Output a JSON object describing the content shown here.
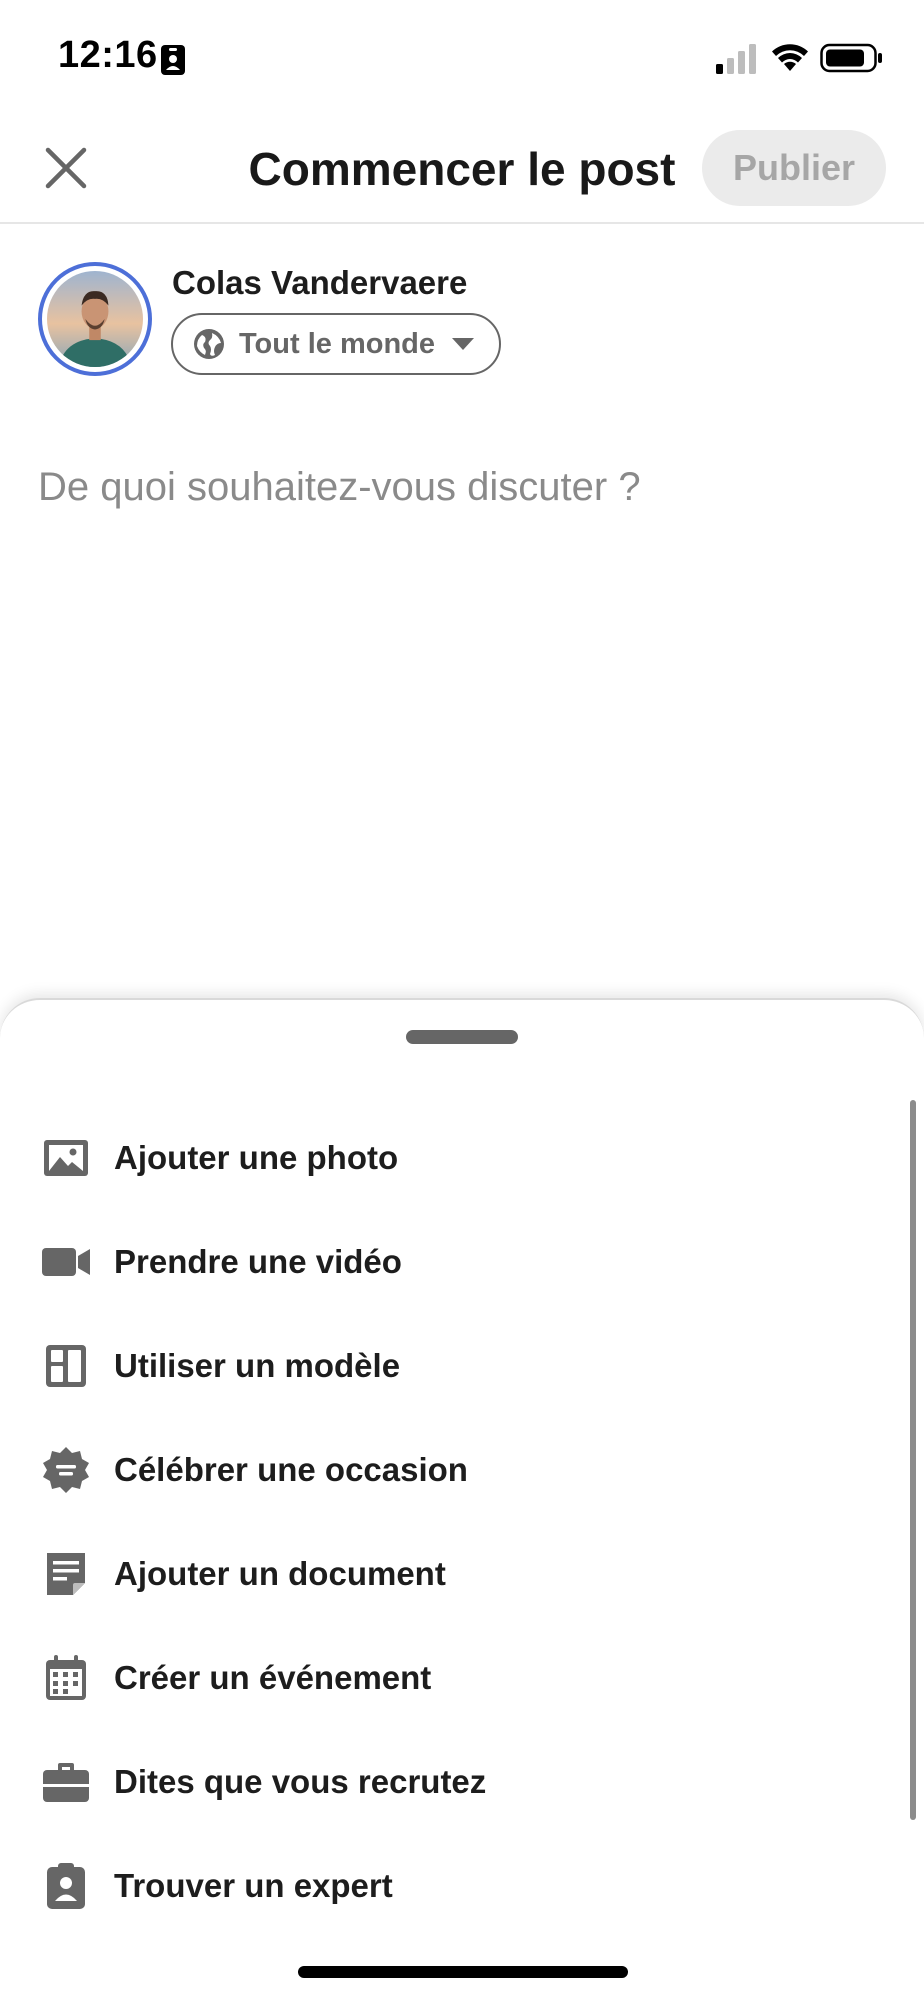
{
  "status_bar": {
    "time": "12:16",
    "badge_icon": "person-badge-icon",
    "signal_icon": "cellular-signal-icon",
    "wifi_icon": "wifi-icon",
    "battery_icon": "battery-icon"
  },
  "header": {
    "close_icon": "close-icon",
    "title": "Commencer le post",
    "publish_label": "Publier"
  },
  "author": {
    "name": "Colas Vandervaere",
    "audience_label": "Tout le monde",
    "audience_icon": "globe-icon"
  },
  "composer": {
    "placeholder": "De quoi souhaitez-vous discuter ?"
  },
  "sheet": {
    "items": [
      {
        "label": "Ajouter une photo",
        "icon": "photo-icon"
      },
      {
        "label": "Prendre une vidéo",
        "icon": "video-camera-icon"
      },
      {
        "label": "Utiliser un modèle",
        "icon": "template-icon"
      },
      {
        "label": "Célébrer une occasion",
        "icon": "celebrate-badge-icon"
      },
      {
        "label": "Ajouter un document",
        "icon": "document-icon"
      },
      {
        "label": "Créer un événement",
        "icon": "calendar-icon"
      },
      {
        "label": "Dites que vous recrutez",
        "icon": "briefcase-icon"
      },
      {
        "label": "Trouver un expert",
        "icon": "expert-badge-icon"
      }
    ]
  },
  "colors": {
    "icon_gray": "#666666",
    "avatar_ring": "#4d6fd8",
    "publish_bg": "#ebebeb",
    "publish_text": "#a6a6a6"
  }
}
